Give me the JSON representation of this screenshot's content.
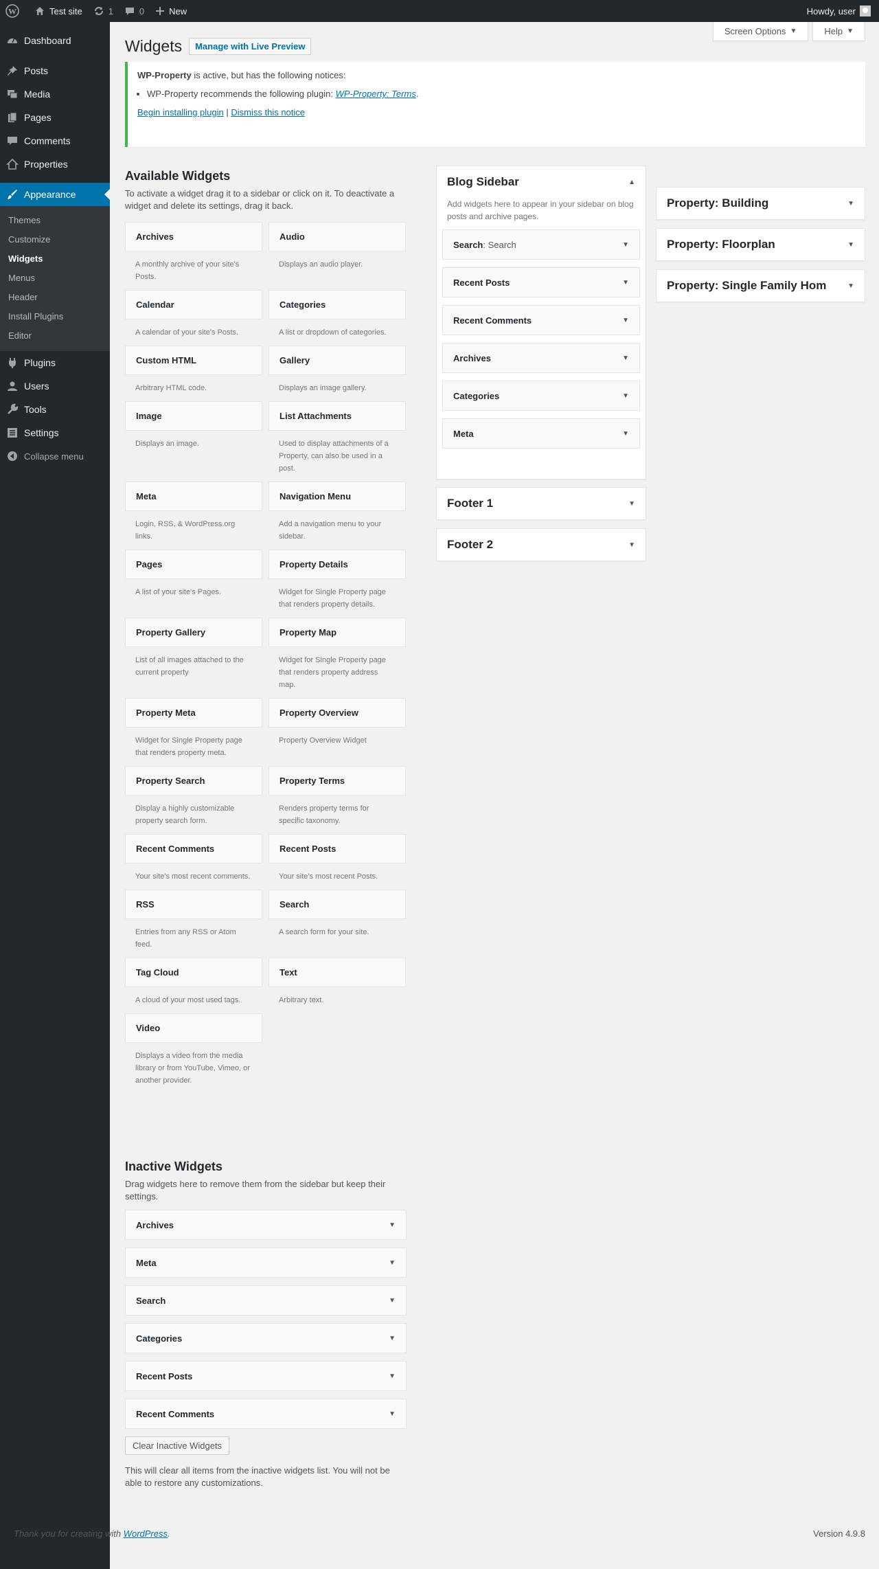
{
  "adminbar": {
    "site_name": "Test site",
    "updates_count": "1",
    "comments_count": "0",
    "new_label": "New",
    "howdy": "Howdy, user"
  },
  "sidebar": {
    "items": [
      {
        "label": "Dashboard",
        "icon": "dashboard-icon"
      },
      {
        "label": "Posts",
        "icon": "pin-icon"
      },
      {
        "label": "Media",
        "icon": "media-icon"
      },
      {
        "label": "Pages",
        "icon": "pages-icon"
      },
      {
        "label": "Comments",
        "icon": "comment-icon"
      },
      {
        "label": "Properties",
        "icon": "home-icon"
      },
      {
        "label": "Appearance",
        "icon": "paintbrush-icon"
      },
      {
        "label": "Plugins",
        "icon": "plugin-icon"
      },
      {
        "label": "Users",
        "icon": "user-icon"
      },
      {
        "label": "Tools",
        "icon": "wrench-icon"
      },
      {
        "label": "Settings",
        "icon": "settings-icon"
      },
      {
        "label": "Collapse menu",
        "icon": "collapse-icon"
      }
    ],
    "submenu": [
      "Themes",
      "Customize",
      "Widgets",
      "Menus",
      "Header",
      "Install Plugins",
      "Editor"
    ]
  },
  "header": {
    "screen_options": "Screen Options",
    "help": "Help",
    "title": "Widgets",
    "live_preview": "Manage with Live Preview"
  },
  "notice": {
    "plugin_name": "WP-Property",
    "line1_rest": " is active, but has the following notices:",
    "recommend": "WP-Property recommends the following plugin: ",
    "recommend_link": "WP-Property: Terms",
    "recommend_end": ".",
    "install_link": "Begin installing plugin",
    "separator": " | ",
    "dismiss_link": "Dismiss this notice"
  },
  "available": {
    "title": "Available Widgets",
    "description": "To activate a widget drag it to a sidebar or click on it. To deactivate a widget and delete its settings, drag it back.",
    "widgets": [
      {
        "title": "Archives",
        "desc": "A monthly archive of your site's Posts."
      },
      {
        "title": "Audio",
        "desc": "Displays an audio player."
      },
      {
        "title": "Calendar",
        "desc": "A calendar of your site's Posts."
      },
      {
        "title": "Categories",
        "desc": "A list or dropdown of categories."
      },
      {
        "title": "Custom HTML",
        "desc": "Arbitrary HTML code."
      },
      {
        "title": "Gallery",
        "desc": "Displays an image gallery."
      },
      {
        "title": "Image",
        "desc": "Displays an image."
      },
      {
        "title": "List Attachments",
        "desc": "Used to display attachments of a Property, can also be used in a post."
      },
      {
        "title": "Meta",
        "desc": "Login, RSS, & WordPress.org links."
      },
      {
        "title": "Navigation Menu",
        "desc": "Add a navigation menu to your sidebar."
      },
      {
        "title": "Pages",
        "desc": "A list of your site's Pages."
      },
      {
        "title": "Property Details",
        "desc": "Widget for Single Property page that renders property details."
      },
      {
        "title": "Property Gallery",
        "desc": "List of all images attached to the current property"
      },
      {
        "title": "Property Map",
        "desc": "Widget for Single Property page that renders property address map."
      },
      {
        "title": "Property Meta",
        "desc": "Widget for Single Property page that renders property meta."
      },
      {
        "title": "Property Overview",
        "desc": "Property Overview Widget"
      },
      {
        "title": "Property Search",
        "desc": "Display a highly customizable property search form."
      },
      {
        "title": "Property Terms",
        "desc": "Renders property terms for specific taxonomy."
      },
      {
        "title": "Recent Comments",
        "desc": "Your site's most recent comments."
      },
      {
        "title": "Recent Posts",
        "desc": "Your site's most recent Posts."
      },
      {
        "title": "RSS",
        "desc": "Entries from any RSS or Atom feed."
      },
      {
        "title": "Search",
        "desc": "A search form for your site."
      },
      {
        "title": "Tag Cloud",
        "desc": "A cloud of your most used tags."
      },
      {
        "title": "Text",
        "desc": "Arbitrary text."
      },
      {
        "title": "Video",
        "desc": "Displays a video from the media library or from YouTube, Vimeo, or another provider."
      }
    ]
  },
  "blog_sidebar": {
    "title": "Blog Sidebar",
    "description": "Add widgets here to appear in your sidebar on blog posts and archive pages.",
    "widgets": [
      {
        "title": "Search",
        "sub": ": Search"
      },
      {
        "title": "Recent Posts",
        "sub": ""
      },
      {
        "title": "Recent Comments",
        "sub": ""
      },
      {
        "title": "Archives",
        "sub": ""
      },
      {
        "title": "Categories",
        "sub": ""
      },
      {
        "title": "Meta",
        "sub": ""
      }
    ]
  },
  "footer1": {
    "title": "Footer 1"
  },
  "footer2": {
    "title": "Footer 2"
  },
  "property_sidebars": [
    "Property: Building",
    "Property: Floorplan",
    "Property: Single Family Hom"
  ],
  "inactive": {
    "title": "Inactive Widgets",
    "description": "Drag widgets here to remove them from the sidebar but keep their settings.",
    "widgets": [
      "Archives",
      "Meta",
      "Search",
      "Categories",
      "Recent Posts",
      "Recent Comments"
    ],
    "clear_button": "Clear Inactive Widgets",
    "clear_note": "This will clear all items from the inactive widgets list. You will not be able to restore any customizations."
  },
  "footer": {
    "thanks": "Thank you for creating with ",
    "wp_link": "WordPress",
    "thanks_end": ".",
    "version": "Version 4.9.8"
  },
  "colors": {
    "accent": "#0073aa",
    "sidebar_bg": "#23282d",
    "notice_border": "#46b450"
  }
}
